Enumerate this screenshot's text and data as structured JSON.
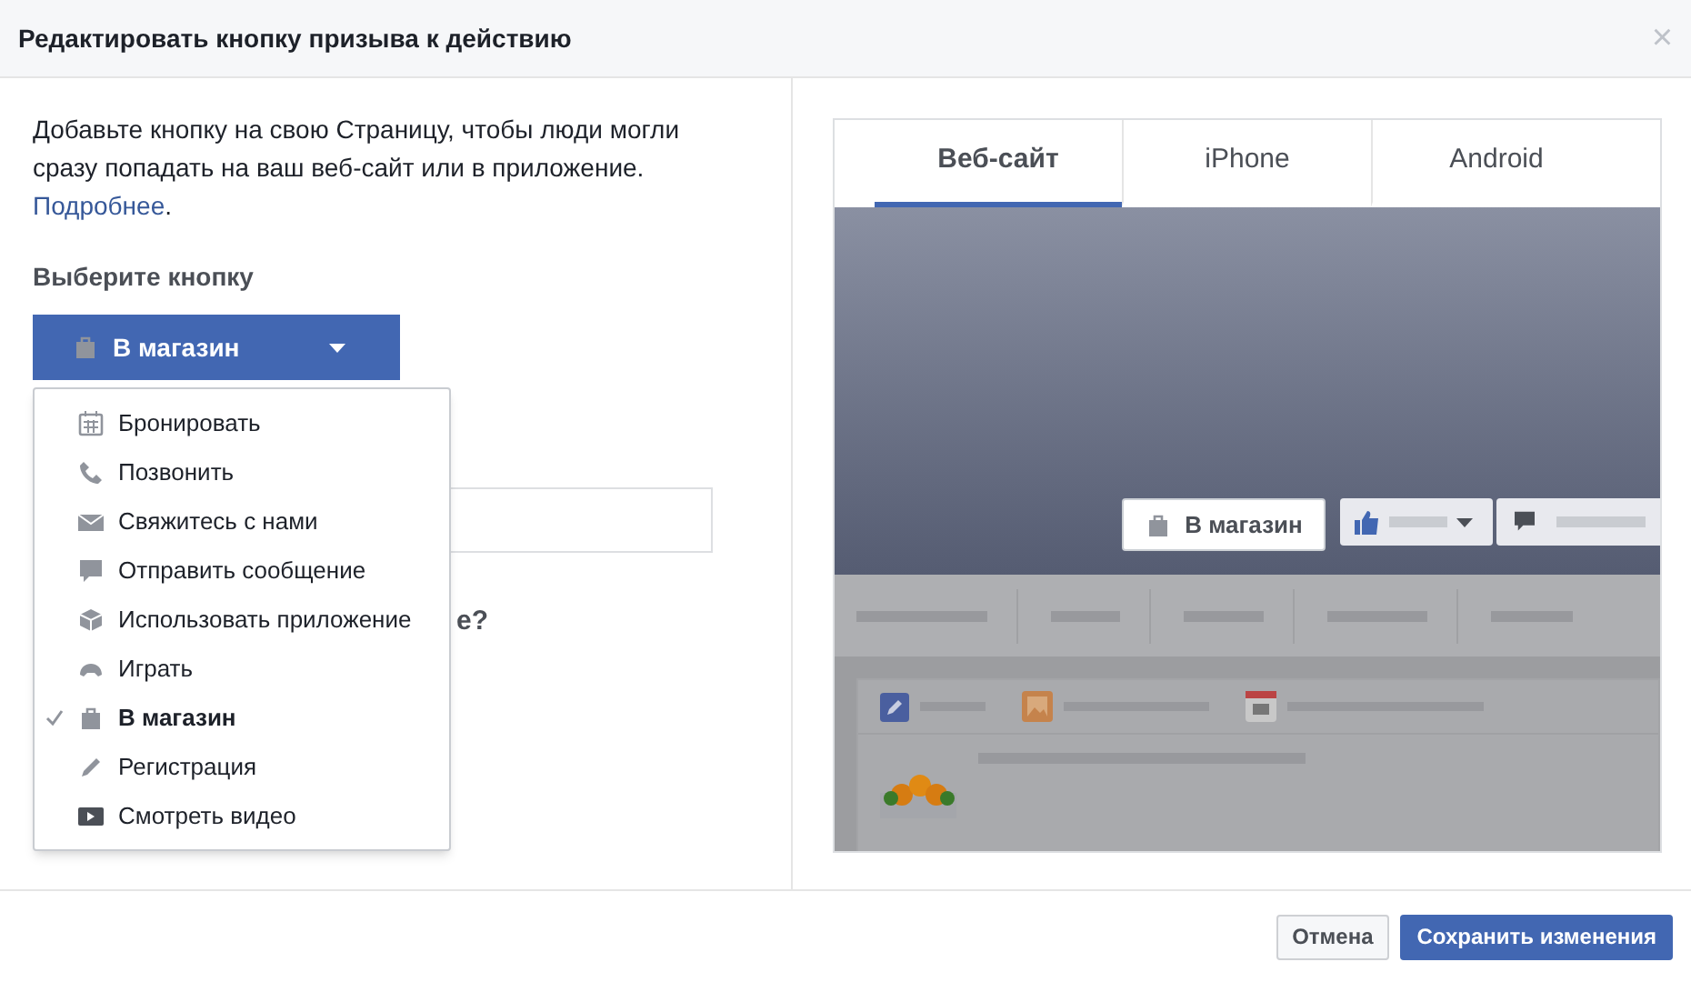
{
  "dialog": {
    "title": "Редактировать кнопку призыва к действию",
    "close": "×"
  },
  "intro": {
    "text": "Добавьте кнопку на свою Страницу, чтобы люди могли сразу попадать на ваш веб-сайт или в приложение.",
    "link": "Подробнее",
    "end": "."
  },
  "choose_label": "Выберите кнопку",
  "dropdown": {
    "label": "В магазин",
    "expanded": true
  },
  "menu": [
    {
      "label": "Бронировать",
      "kind": "calendar",
      "selected": false
    },
    {
      "label": "Позвонить",
      "kind": "phone",
      "selected": false
    },
    {
      "label": "Свяжитесь с нами",
      "kind": "mail",
      "selected": false
    },
    {
      "label": "Отправить сообщение",
      "kind": "bubble",
      "selected": false
    },
    {
      "label": "Использовать приложение",
      "kind": "cube",
      "selected": false
    },
    {
      "label": "Играть",
      "kind": "gamepad",
      "selected": false
    },
    {
      "label": "В магазин",
      "kind": "bag",
      "selected": true
    },
    {
      "label": "Регистрация",
      "kind": "pencil",
      "selected": false
    },
    {
      "label": "Смотреть видео",
      "kind": "video",
      "selected": false
    }
  ],
  "hidden_heading_tail": "е?",
  "preview": {
    "tabs": [
      {
        "label": "Веб-сайт",
        "selected": true
      },
      {
        "label": "iPhone",
        "selected": false
      },
      {
        "label": "Android",
        "selected": false
      }
    ],
    "cta_button": "В магазин"
  },
  "footer": {
    "cancel": "Отмена",
    "save": "Сохранить изменения"
  }
}
